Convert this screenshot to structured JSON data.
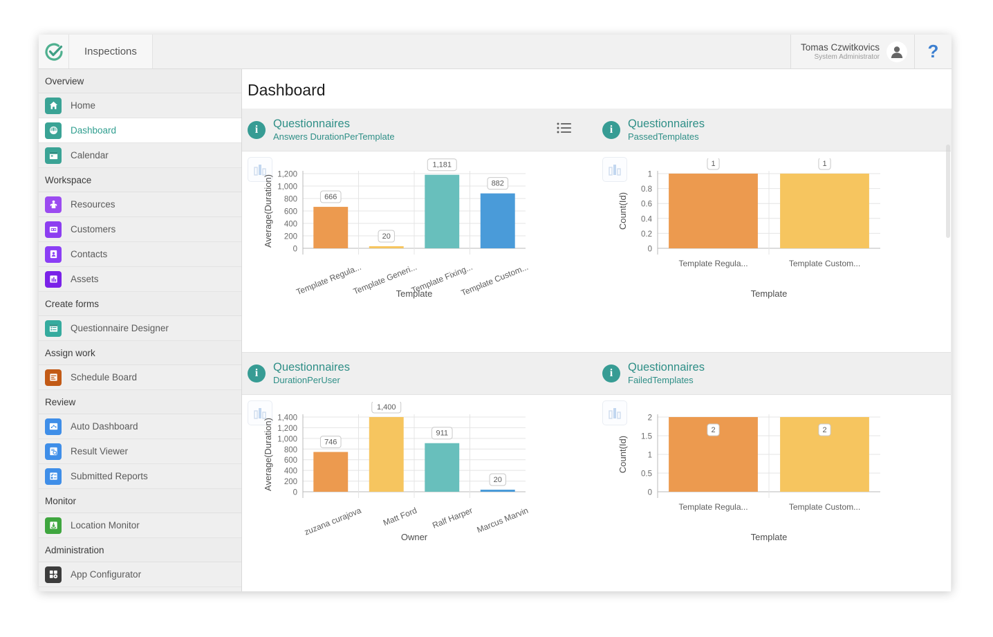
{
  "topbar": {
    "logo_icon": "check-circle-logo",
    "app_tab": "Inspections",
    "user_name": "Tomas Czwitkovics",
    "user_role": "System Administrator",
    "avatar_icon": "person-icon",
    "help_label": "?"
  },
  "sidebar": {
    "groups": [
      {
        "label": "Overview",
        "items": [
          {
            "label": "Home",
            "icon": "home-icon",
            "color": "#3aa395",
            "active": false
          },
          {
            "label": "Dashboard",
            "icon": "dashboard-icon",
            "color": "#3aa395",
            "active": true
          },
          {
            "label": "Calendar",
            "icon": "calendar-icon",
            "color": "#3aa395",
            "active": false
          }
        ]
      },
      {
        "label": "Workspace",
        "items": [
          {
            "label": "Resources",
            "icon": "resources-icon",
            "color": "#9b4bf0",
            "active": false
          },
          {
            "label": "Customers",
            "icon": "customers-icon",
            "color": "#8c3ef0",
            "active": false
          },
          {
            "label": "Contacts",
            "icon": "contacts-icon",
            "color": "#8b3ef5",
            "active": false
          },
          {
            "label": "Assets",
            "icon": "assets-icon",
            "color": "#7a22e8",
            "active": false
          }
        ]
      },
      {
        "label": "Create forms",
        "items": [
          {
            "label": "Questionnaire Designer",
            "icon": "form-list-icon",
            "color": "#35ab9e",
            "active": false
          }
        ]
      },
      {
        "label": "Assign work",
        "items": [
          {
            "label": "Schedule Board",
            "icon": "schedule-board-icon",
            "color": "#c25a16",
            "active": false
          }
        ]
      },
      {
        "label": "Review",
        "items": [
          {
            "label": "Auto Dashboard",
            "icon": "auto-dashboard-icon",
            "color": "#3f8ee8",
            "active": false
          },
          {
            "label": "Result Viewer",
            "icon": "result-viewer-icon",
            "color": "#3f8ee8",
            "active": false
          },
          {
            "label": "Submitted Reports",
            "icon": "submitted-reports-icon",
            "color": "#3f8ee8",
            "active": false
          }
        ]
      },
      {
        "label": "Monitor",
        "items": [
          {
            "label": "Location Monitor",
            "icon": "location-monitor-icon",
            "color": "#3fa63f",
            "active": false
          }
        ]
      },
      {
        "label": "Administration",
        "items": [
          {
            "label": "App Configurator",
            "icon": "app-configurator-icon",
            "color": "#3c3c3c",
            "active": false
          }
        ]
      }
    ]
  },
  "main": {
    "page_title": "Dashboard"
  },
  "panels": [
    {
      "title": "Questionnaires",
      "subtitle": "Answers DurationPerTemplate",
      "info_icon": "info-icon",
      "chart_toggle_icon": "bar-chart-icon",
      "list_icon": null
    },
    {
      "title": "Questionnaires",
      "subtitle": "PassedTemplates",
      "info_icon": "info-icon",
      "chart_toggle_icon": "bar-chart-icon",
      "list_icon": "list-view-icon"
    },
    {
      "title": "Questionnaires",
      "subtitle": "DurationPerUser",
      "info_icon": "info-icon",
      "chart_toggle_icon": "bar-chart-icon",
      "list_icon": null
    },
    {
      "title": "Questionnaires",
      "subtitle": "FailedTemplates",
      "info_icon": "info-icon",
      "chart_toggle_icon": "bar-chart-icon",
      "list_icon": null
    }
  ],
  "palette": {
    "orange": "#ec9a4f",
    "yellow": "#f6c55f",
    "teal": "#68bfbc",
    "blue": "#4a9bd9",
    "accent": "#2f8f87",
    "grid": "#e4e4e4",
    "axis": "#b9b9b9"
  },
  "chart_data": [
    {
      "id": "answers-duration-per-template",
      "type": "bar",
      "title": "Answers DurationPerTemplate",
      "xlabel": "Template",
      "ylabel": "Average(Duration)",
      "categories": [
        "Template Regula...",
        "Template Generi...",
        "Template Fixing...",
        "Template Custom..."
      ],
      "values": [
        666,
        20,
        1181,
        882
      ],
      "data_labels": [
        "666",
        "20",
        "1,181",
        "882"
      ],
      "colors": [
        "#ec9a4f",
        "#f6c55f",
        "#68bfbc",
        "#4a9bd9"
      ],
      "ylim": [
        0,
        1200
      ],
      "yticks": [
        0,
        200,
        400,
        600,
        800,
        1000,
        1200
      ],
      "ytick_labels": [
        "0",
        "200",
        "400",
        "600",
        "800",
        "1,000",
        "1,200"
      ],
      "grid": true,
      "legend": "none"
    },
    {
      "id": "passed-templates",
      "type": "bar",
      "title": "PassedTemplates",
      "xlabel": "Template",
      "ylabel": "Count(Id)",
      "categories": [
        "Template Regula...",
        "Template Custom..."
      ],
      "values": [
        1,
        1
      ],
      "data_labels": [
        "1",
        "1"
      ],
      "colors": [
        "#ec9a4f",
        "#f6c55f"
      ],
      "ylim": [
        0,
        1
      ],
      "yticks": [
        0,
        0.2,
        0.4,
        0.6,
        0.8,
        1
      ],
      "ytick_labels": [
        "0",
        "0.2",
        "0.4",
        "0.6",
        "0.8",
        "1"
      ],
      "grid": true,
      "legend": "none"
    },
    {
      "id": "duration-per-user",
      "type": "bar",
      "title": "DurationPerUser",
      "xlabel": "Owner",
      "ylabel": "Average(Duration)",
      "categories": [
        "zuzana curajova",
        "Matt Ford",
        "Ralf Harper",
        "Marcus Marvin"
      ],
      "values": [
        746,
        1400,
        911,
        20
      ],
      "data_labels": [
        "746",
        "1,400",
        "911",
        "20"
      ],
      "colors": [
        "#ec9a4f",
        "#f6c55f",
        "#68bfbc",
        "#4a9bd9"
      ],
      "ylim": [
        0,
        1400
      ],
      "yticks": [
        0,
        200,
        400,
        600,
        800,
        1000,
        1200,
        1400
      ],
      "ytick_labels": [
        "0",
        "200",
        "400",
        "600",
        "800",
        "1,000",
        "1,200",
        "1,400"
      ],
      "grid": true,
      "legend": "none"
    },
    {
      "id": "failed-templates",
      "type": "bar",
      "title": "FailedTemplates",
      "xlabel": "Template",
      "ylabel": "Count(Id)",
      "categories": [
        "Template Regula...",
        "Template Custom..."
      ],
      "values": [
        2,
        2
      ],
      "data_labels": [
        "2",
        "2"
      ],
      "colors": [
        "#ec9a4f",
        "#f6c55f"
      ],
      "ylim": [
        0,
        2
      ],
      "yticks": [
        0,
        0.5,
        1,
        1.5,
        2
      ],
      "ytick_labels": [
        "0",
        "0.5",
        "1",
        "1.5",
        "2"
      ],
      "grid": true,
      "legend": "none"
    }
  ]
}
